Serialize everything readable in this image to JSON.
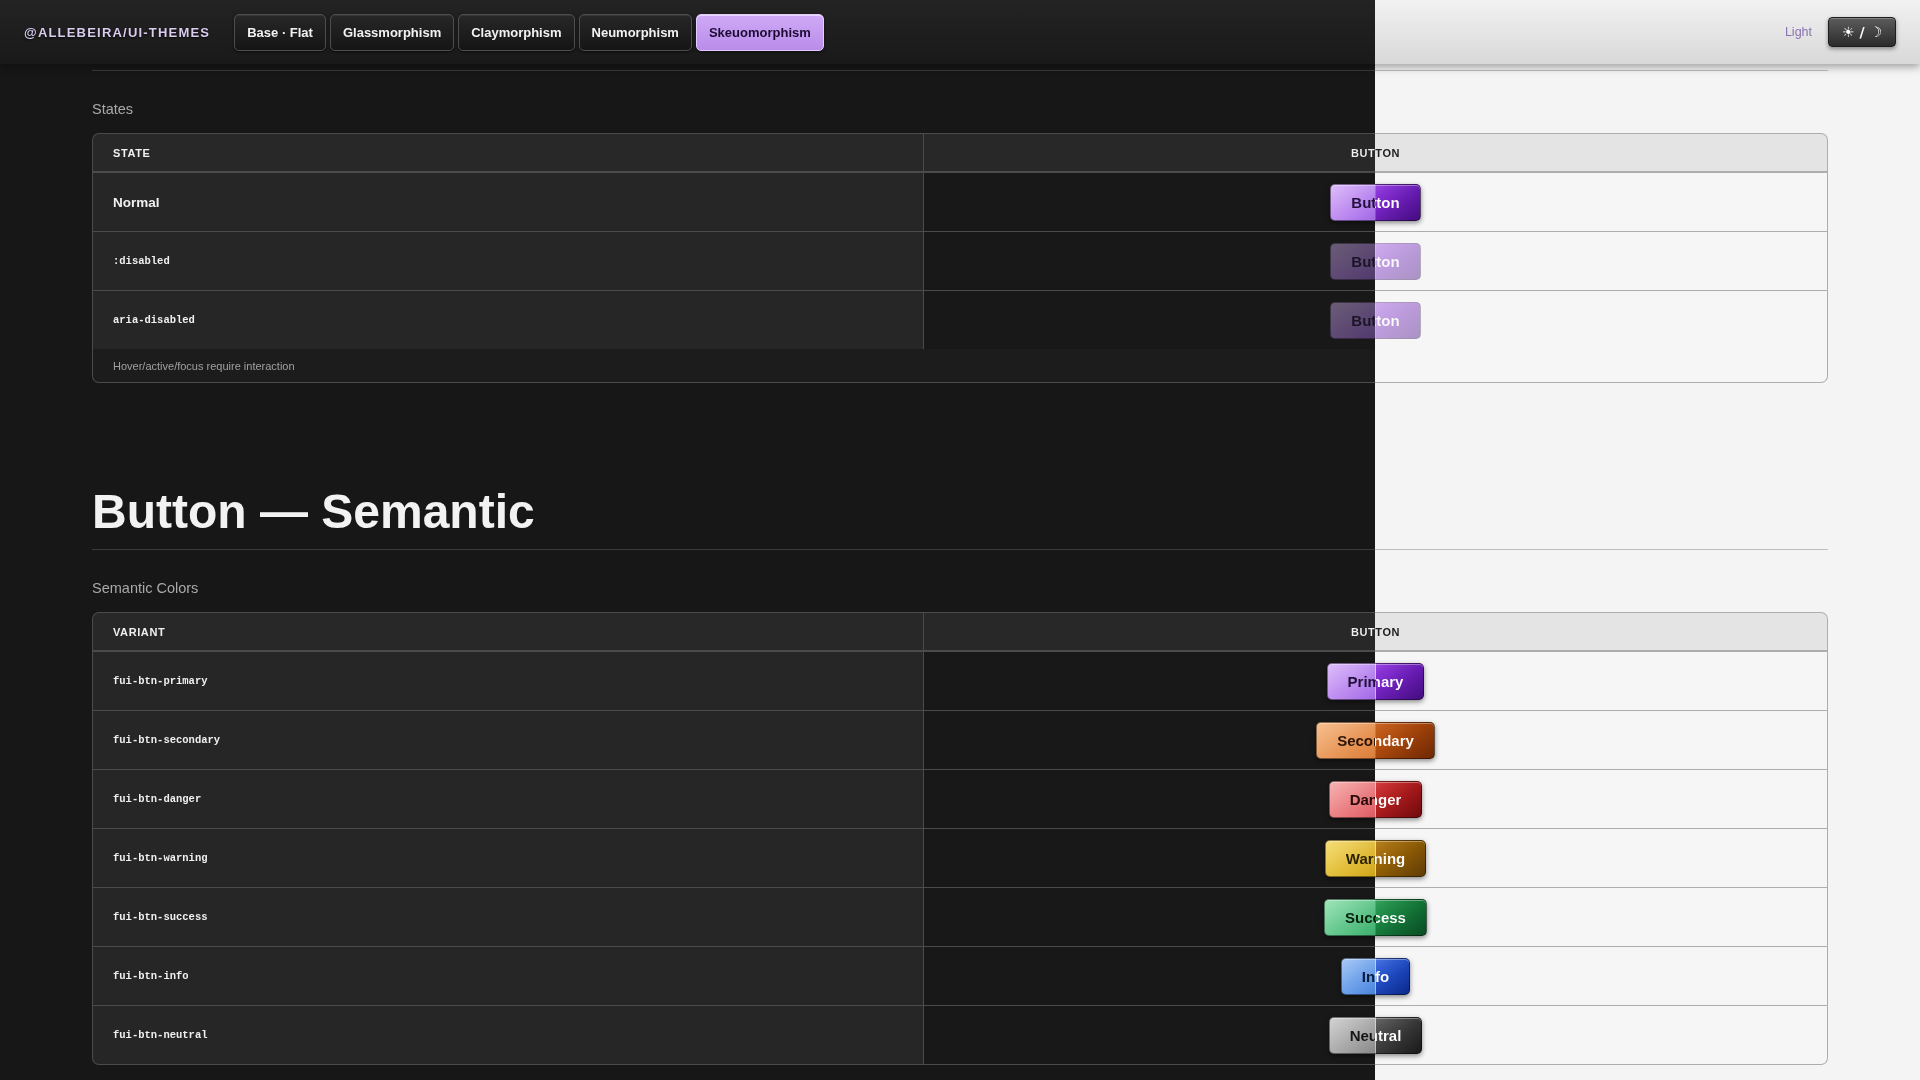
{
  "topbar": {
    "brand": "@ALLEBEIRA/UI-THEMES",
    "tabs": [
      {
        "label": "Base · Flat",
        "selected": false
      },
      {
        "label": "Glassmorphism",
        "selected": false
      },
      {
        "label": "Claymorphism",
        "selected": false
      },
      {
        "label": "Neumorphism",
        "selected": false
      },
      {
        "label": "Skeuomorphism",
        "selected": true
      }
    ],
    "mode_label": "Light",
    "theme_toggle": "☀ / ☽"
  },
  "states_section": {
    "title": "States",
    "table": {
      "columns": [
        "STATE",
        "BUTTON"
      ],
      "rows": [
        {
          "label": "Normal",
          "kind": "text",
          "button": "Button",
          "disabled": false
        },
        {
          "label": ":disabled",
          "kind": "code",
          "button": "Button",
          "disabled": true
        },
        {
          "label": "aria-disabled",
          "kind": "code",
          "button": "Button",
          "disabled": true
        }
      ],
      "footnote": "Hover/active/focus require interaction"
    }
  },
  "semantic_section": {
    "heading": "Button — Semantic",
    "title": "Semantic Colors",
    "table": {
      "columns": [
        "VARIANT",
        "BUTTON"
      ],
      "rows": [
        {
          "label": "fui-btn-primary",
          "kind": "primary",
          "button": "Primary"
        },
        {
          "label": "fui-btn-secondary",
          "kind": "secondary",
          "button": "Secondary"
        },
        {
          "label": "fui-btn-danger",
          "kind": "danger",
          "button": "Danger"
        },
        {
          "label": "fui-btn-warning",
          "kind": "warning",
          "button": "Warning"
        },
        {
          "label": "fui-btn-success",
          "kind": "success",
          "button": "Success"
        },
        {
          "label": "fui-btn-info",
          "kind": "info",
          "button": "Info"
        },
        {
          "label": "fui-btn-neutral",
          "kind": "neutral",
          "button": "Neutral"
        }
      ]
    }
  }
}
